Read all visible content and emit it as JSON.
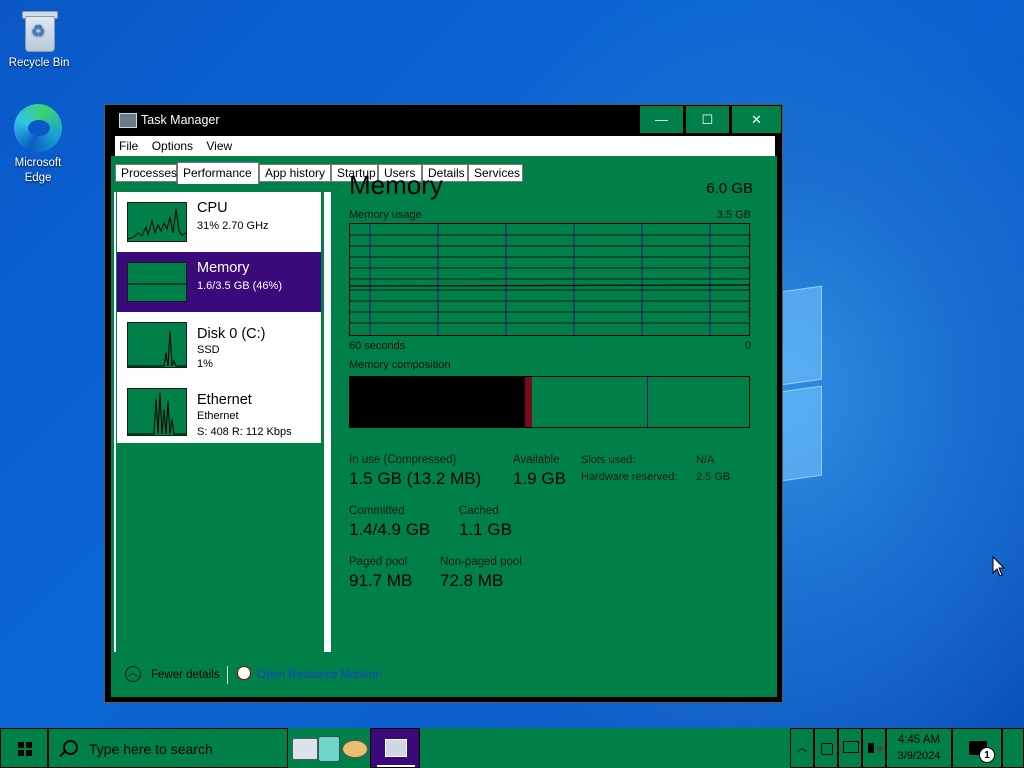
{
  "desktop": {
    "icons": [
      {
        "label": "Recycle Bin"
      },
      {
        "label_line1": "Microsoft",
        "label_line2": "Edge"
      }
    ]
  },
  "window": {
    "title": "Task Manager",
    "controls": {
      "minimize": "—",
      "maximize": "☐",
      "close": "✕"
    },
    "menu": [
      "File",
      "Options",
      "View"
    ],
    "tabs": [
      "Processes",
      "Performance",
      "App history",
      "Startup",
      "Users",
      "Details",
      "Services"
    ],
    "active_tab": "Performance"
  },
  "sidebar": {
    "items": [
      {
        "name": "CPU",
        "line1": "31% 2.70 GHz"
      },
      {
        "name": "Memory",
        "line1": "1.6/3.5 GB (46%)"
      },
      {
        "name": "Disk 0 (C:)",
        "line1": "SSD",
        "line2": "1%"
      },
      {
        "name": "Ethernet",
        "line1": "Ethernet",
        "line2": "S: 408 R: 112 Kbps"
      }
    ],
    "selected": "Memory"
  },
  "memory": {
    "title": "Memory",
    "total": "6.0 GB",
    "usage_label": "Memory usage",
    "usage_max": "3.5 GB",
    "time_left": "60 seconds",
    "time_right": "0",
    "composition_label": "Memory composition",
    "stats": {
      "in_use_label": "In use (Compressed)",
      "in_use_value": "1.5 GB (13.2 MB)",
      "available_label": "Available",
      "available_value": "1.9 GB",
      "committed_label": "Committed",
      "committed_value": "1.4/4.9 GB",
      "cached_label": "Cached",
      "cached_value": "1.1 GB",
      "paged_label": "Paged pool",
      "paged_value": "91.7 MB",
      "nonpaged_label": "Non-paged pool",
      "nonpaged_value": "72.8 MB",
      "slots_label": "Slots used:",
      "slots_value": "N/A",
      "hw_label": "Hardware reserved:",
      "hw_value": "2.5 GB"
    }
  },
  "footer": {
    "fewer_details": "Fewer details",
    "resource_monitor": "Open Resource Monitor"
  },
  "taskbar": {
    "search_placeholder": "Type here to search",
    "time": "4:45 AM",
    "date": "3/9/2024",
    "notification_count": "1"
  },
  "colors": {
    "window_bg": "#008049",
    "selected_bg": "#3b0a7a",
    "desktop": "#0a58c8"
  }
}
